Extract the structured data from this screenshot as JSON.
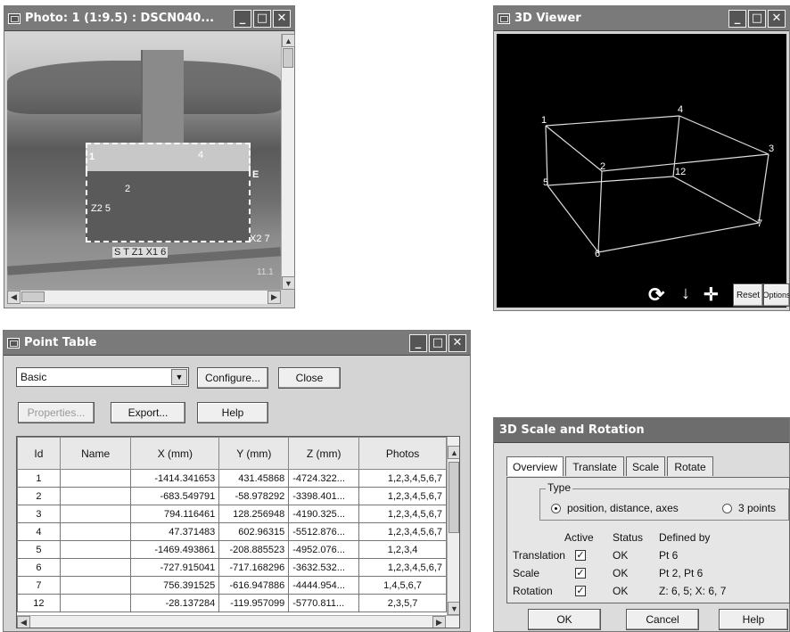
{
  "photo_window": {
    "title": "Photo: 1 (1:9.5) : DSCN040...",
    "labels": {
      "p1": "1",
      "p4": "4",
      "p2": "2",
      "z2_5": "Z2 5",
      "bottom": "S  T  Z1  X1  6",
      "x2_7": "X2 7",
      "e": "E",
      "n11": "11.1"
    }
  },
  "viewer_window": {
    "title": "3D Viewer",
    "points": [
      "1",
      "4",
      "3",
      "2",
      "12",
      "5",
      "6",
      "7"
    ],
    "reset_label": "Reset",
    "options_label": "Options"
  },
  "point_table": {
    "title": "Point Table",
    "view_select": "Basic",
    "configure_label": "Configure...",
    "close_label": "Close",
    "properties_label": "Properties...",
    "export_label": "Export...",
    "help_label": "Help",
    "columns": [
      "Id",
      "Name",
      "X (mm)",
      "Y (mm)",
      "Z (mm)",
      "Photos"
    ],
    "rows": [
      [
        "1",
        "",
        "-1414.341653",
        "431.45868",
        "-4724.322...",
        "1,2,3,4,5,6,7"
      ],
      [
        "2",
        "",
        "-683.549791",
        "-58.978292",
        "-3398.401...",
        "1,2,3,4,5,6,7"
      ],
      [
        "3",
        "",
        "794.116461",
        "128.256948",
        "-4190.325...",
        "1,2,3,4,5,6,7"
      ],
      [
        "4",
        "",
        "47.371483",
        "602.96315",
        "-5512.876...",
        "1,2,3,4,5,6,7"
      ],
      [
        "5",
        "",
        "-1469.493861",
        "-208.885523",
        "-4952.076...",
        "1,2,3,4"
      ],
      [
        "6",
        "",
        "-727.915041",
        "-717.168296",
        "-3632.532...",
        "1,2,3,4,5,6,7"
      ],
      [
        "7",
        "",
        "756.391525",
        "-616.947886",
        "-4444.954...",
        "1,4,5,6,7"
      ],
      [
        "12",
        "",
        "-28.137284",
        "-119.957099",
        "-5770.811...",
        "2,3,5,7"
      ]
    ]
  },
  "scale_rotation": {
    "title": "3D Scale and Rotation",
    "tabs": [
      "Overview",
      "Translate",
      "Scale",
      "Rotate"
    ],
    "type_group": "Type",
    "type_option1": "position, distance, axes",
    "type_option2": "3 points",
    "headers": {
      "active": "Active",
      "status": "Status",
      "defined_by": "Defined by"
    },
    "rows": [
      {
        "name": "Translation",
        "status": "OK",
        "defined_by": "Pt 6"
      },
      {
        "name": "Scale",
        "status": "OK",
        "defined_by": "Pt 2, Pt 6"
      },
      {
        "name": "Rotation",
        "status": "OK",
        "defined_by": "Z: 6, 5; X: 6, 7"
      }
    ],
    "ok_label": "OK",
    "cancel_label": "Cancel",
    "help_label": "Help"
  }
}
